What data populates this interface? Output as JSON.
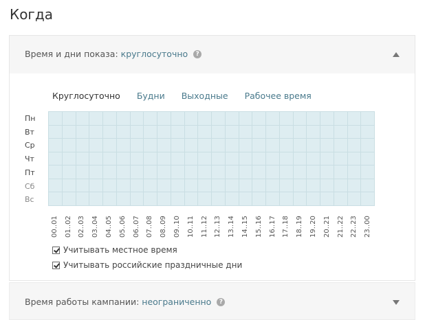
{
  "page": {
    "title": "Когда"
  },
  "schedule_panel": {
    "label": "Время и дни показа:",
    "value": "круглосуточно",
    "help_glyph": "?",
    "toggle_icon": "chevron-up-icon",
    "presets": [
      {
        "label": "Круглосуточно",
        "active": true
      },
      {
        "label": "Будни",
        "active": false
      },
      {
        "label": "Выходные",
        "active": false
      },
      {
        "label": "Рабочее время",
        "active": false
      }
    ],
    "days": [
      "Пн",
      "Вт",
      "Ср",
      "Чт",
      "Пт",
      "Сб",
      "Вс"
    ],
    "weekend_days": [
      "Сб",
      "Вс"
    ],
    "hours": [
      "00..01",
      "01..02",
      "02..03",
      "03..04",
      "04..05",
      "05..06",
      "06..07",
      "07..08",
      "08..09",
      "09..10",
      "10..11",
      "11..12",
      "12..13",
      "13..14",
      "14..15",
      "15..16",
      "16..17",
      "17..18",
      "18..19",
      "19..20",
      "20..21",
      "21..22",
      "22..23",
      "23..00"
    ],
    "grid_color": "#deedf1",
    "options": [
      {
        "label": "Учитывать местное время",
        "checked": true
      },
      {
        "label": "Учитывать российские праздничные дни",
        "checked": true
      }
    ]
  },
  "campaign_panel": {
    "label": "Время работы кампании:",
    "value": "неограниченно",
    "help_glyph": "?",
    "toggle_icon": "chevron-down-icon"
  },
  "colors": {
    "link": "#4a7a8c",
    "header_bg": "#f6f6f6"
  }
}
